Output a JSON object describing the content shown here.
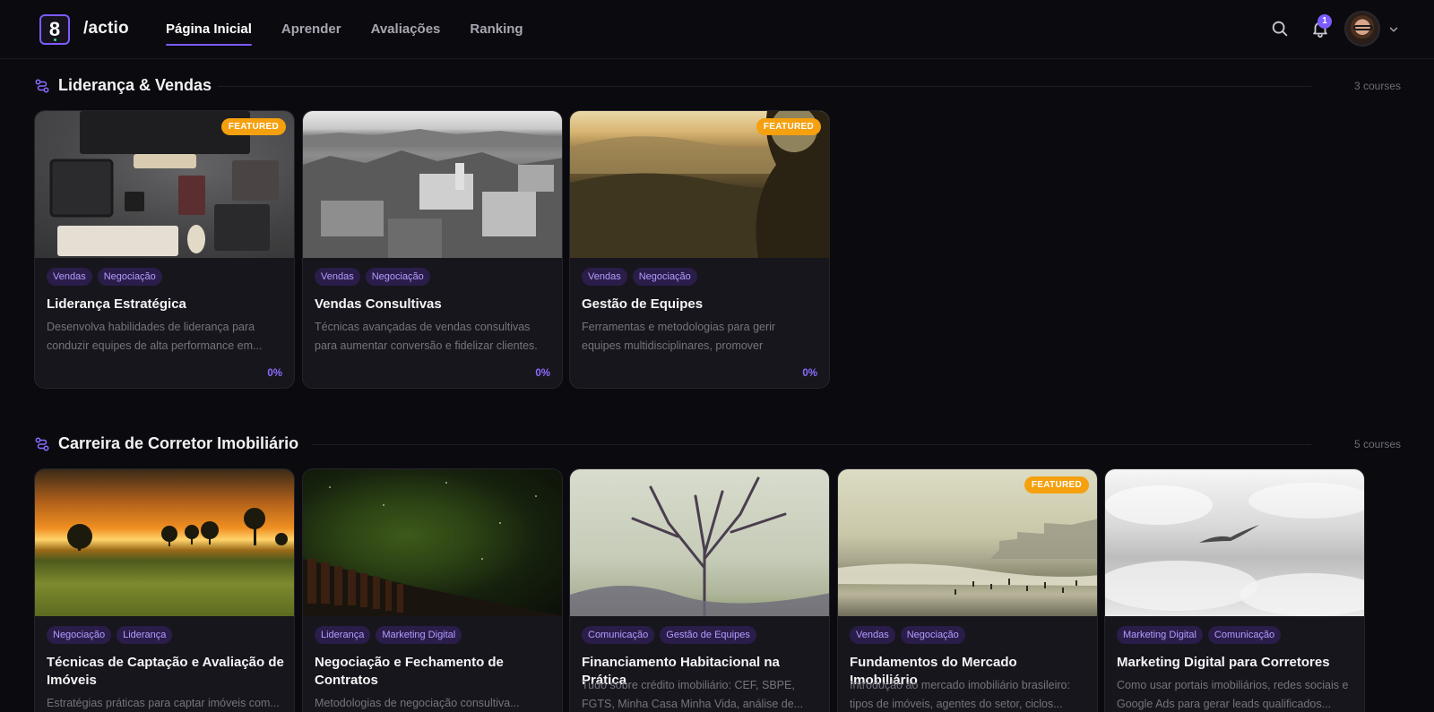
{
  "header": {
    "brand": "/actio",
    "logo_glyph": "8",
    "nav": [
      "Página Inicial",
      "Aprender",
      "Avaliações",
      "Ranking"
    ],
    "active_nav": "Página Inicial",
    "notification_count": "1",
    "icons": [
      "search-icon",
      "bell-icon",
      "chevron-down-icon"
    ]
  },
  "sections": [
    {
      "title": "Liderança & Vendas",
      "count": "3 courses",
      "courses": [
        {
          "featured": "FEATURED",
          "tags": [
            "Vendas",
            "Negociação"
          ],
          "title": "Liderança Estratégica",
          "description": "Desenvolva habilidades de liderança para conduzir equipes de alta performance em...",
          "progress": "0%"
        },
        {
          "featured": "",
          "tags": [
            "Vendas",
            "Negociação"
          ],
          "title": "Vendas Consultivas",
          "description": "Técnicas avançadas de vendas consultivas para aumentar conversão e fidelizar clientes.",
          "progress": "0%"
        },
        {
          "featured": "FEATURED",
          "tags": [
            "Vendas",
            "Negociação"
          ],
          "title": "Gestão de Equipes",
          "description": "Ferramentas e metodologias para gerir equipes multidisciplinares, promover engajamento e...",
          "progress": "0%"
        }
      ]
    },
    {
      "title": "Carreira de Corretor Imobiliário",
      "count": "5 courses",
      "courses": [
        {
          "featured": "",
          "tags": [
            "Negociação",
            "Liderança"
          ],
          "title": "Técnicas de Captação e Avaliação de Imóveis",
          "description": "Estratégias práticas para captar imóveis com...",
          "progress": ""
        },
        {
          "featured": "",
          "tags": [
            "Liderança",
            "Marketing Digital"
          ],
          "title": "Negociação e Fechamento de Contratos",
          "description": "Metodologias de negociação consultiva...",
          "progress": ""
        },
        {
          "featured": "",
          "tags": [
            "Comunicação",
            "Gestão de Equipes"
          ],
          "title": "Financiamento Habitacional na Prática",
          "description": "Tudo sobre crédito imobiliário: CEF, SBPE, FGTS, Minha Casa Minha Vida, análise de...",
          "progress": ""
        },
        {
          "featured": "FEATURED",
          "tags": [
            "Vendas",
            "Negociação"
          ],
          "title": "Fundamentos do Mercado Imobiliário",
          "description": "Introdução ao mercado imobiliário brasileiro: tipos de imóveis, agentes do setor, ciclos...",
          "progress": ""
        },
        {
          "featured": "",
          "tags": [
            "Marketing Digital",
            "Comunicação"
          ],
          "title": "Marketing Digital para Corretores",
          "description": "Como usar portais imobiliários, redes sociais e Google Ads para gerar leads qualificados...",
          "progress": ""
        }
      ]
    }
  ],
  "colors": {
    "accent": "#7c5cff",
    "featured": "#f5a00f",
    "background": "#0b0a0e",
    "card": "#17161c"
  }
}
